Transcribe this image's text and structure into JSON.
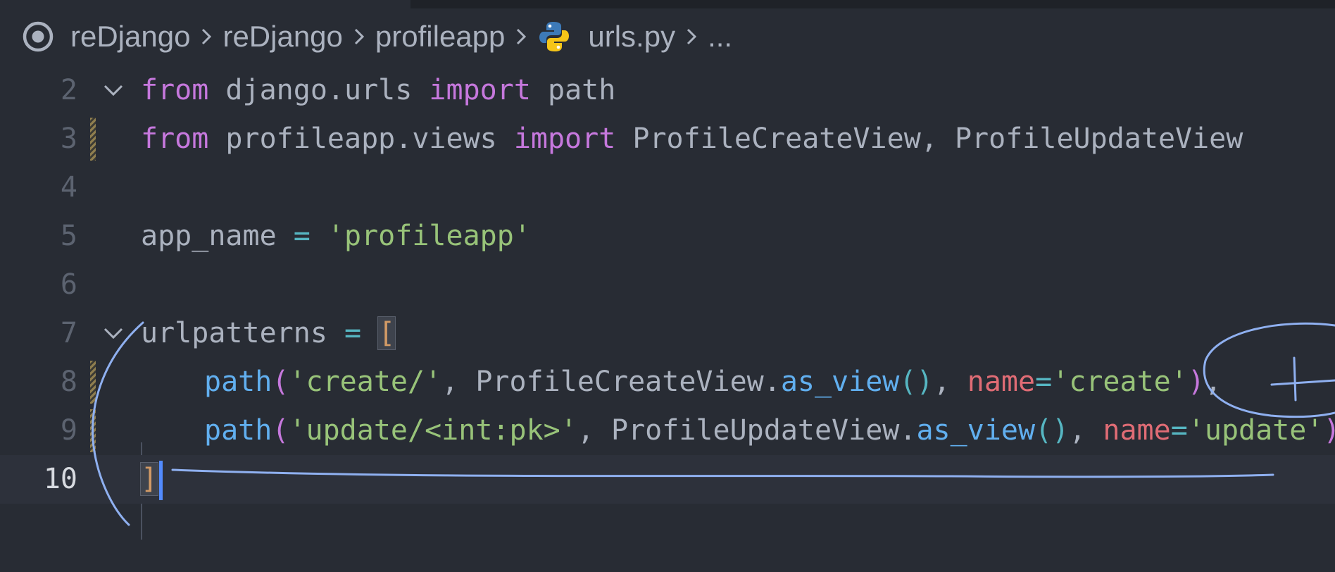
{
  "breadcrumb": {
    "items": [
      "reDjango",
      "reDjango",
      "profileapp",
      "urls.py",
      "..."
    ]
  },
  "editor": {
    "line_numbers": [
      "2",
      "3",
      "4",
      "5",
      "6",
      "7",
      "8",
      "9",
      "10"
    ],
    "lines": {
      "l2": [
        "from",
        " django.urls ",
        "import",
        " path"
      ],
      "l3": [
        "from",
        " profileapp.views ",
        "import",
        " ProfileCreateView, ProfileUpdateView"
      ],
      "l5": [
        "app_name",
        " ",
        "=",
        " ",
        "'profileapp'"
      ],
      "l7": [
        "urlpatterns",
        " ",
        "=",
        " ",
        "["
      ],
      "l8": [
        "path",
        "(",
        "'create/'",
        ", ProfileCreateView.",
        "as_view",
        "()",
        ", ",
        "name",
        "=",
        "'create'",
        ")",
        ","
      ],
      "l9": [
        "path",
        "(",
        "'update/<int:pk>'",
        ", ProfileUpdateView.",
        "as_view",
        "()",
        ", ",
        "name",
        "=",
        "'update'",
        ")",
        ","
      ],
      "l10": [
        "]"
      ]
    }
  },
  "colors": {
    "background": "#282c34",
    "keyword": "#c678dd",
    "string": "#98c379",
    "function": "#61afef",
    "operator": "#56b6c2",
    "param": "#e06c75",
    "bracket": "#d19a66",
    "annotation": "#8fb0f0"
  },
  "icons": {
    "target": "target-icon",
    "python": "python-icon",
    "chevron": "chevron-right-icon",
    "fold": "chevron-down-icon"
  }
}
